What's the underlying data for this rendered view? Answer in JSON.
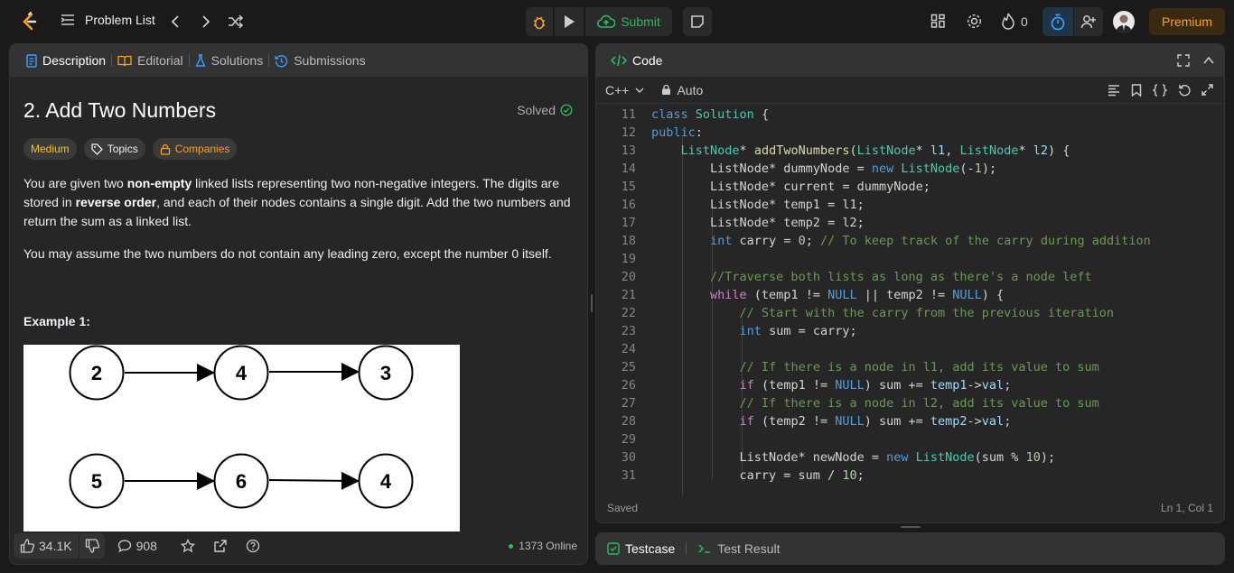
{
  "topbar": {
    "problem_list": "Problem List",
    "submit": "Submit",
    "streak_count": "0",
    "premium": "Premium"
  },
  "icons": [
    "leetcode-logo",
    "list-icon",
    "chevron-left-icon",
    "chevron-right-icon",
    "shuffle-icon",
    "debug-icon",
    "play-icon",
    "cloud-upload-icon",
    "note-icon",
    "layout-icon",
    "gear-icon",
    "fire-icon",
    "timer-icon",
    "add-person-icon",
    "avatar"
  ],
  "left": {
    "tabs": [
      "Description",
      "Editorial",
      "Solutions",
      "Submissions"
    ],
    "title": "2. Add Two Numbers",
    "solved": "Solved",
    "chips": {
      "difficulty": "Medium",
      "topics": "Topics",
      "companies": "Companies"
    },
    "p1_a": "You are given two ",
    "p1_b": "non-empty",
    "p1_c": " linked lists representing two non-negative integers. The digits are stored in ",
    "p1_d": "reverse order",
    "p1_e": ", and each of their nodes contains a single digit. Add the two numbers and return the sum as a linked list.",
    "p2": "You may assume the two numbers do not contain any leading zero, except the number 0 itself.",
    "example": "Example 1:",
    "diagram": {
      "row1": [
        "2",
        "4",
        "3"
      ],
      "row2": [
        "5",
        "6",
        "4"
      ]
    },
    "footer": {
      "likes": "34.1K",
      "comments": "908",
      "online": "1373 Online"
    }
  },
  "code": {
    "tab": "Code",
    "language": "C++",
    "mode": "Auto",
    "status_left": "Saved",
    "status_right": "Ln 1, Col 1",
    "lines": [
      {
        "n": "11",
        "html": "<span class=\"kw\">class</span> <span class=\"ty\">Solution</span> {"
      },
      {
        "n": "12",
        "html": "<span class=\"kw\">public</span>:"
      },
      {
        "n": "13",
        "html": "    <span class=\"ty\">ListNode</span>* <span class=\"fn\">addTwoNumbers</span>(<span class=\"ty\">ListNode</span>* <span class=\"va\">l1</span>, <span class=\"ty\">ListNode</span>* <span class=\"va\">l2</span>) {"
      },
      {
        "n": "14",
        "html": "        ListNode* dummyNode = <span class=\"kw\">new</span> <span class=\"ty\">ListNode</span>(-<span class=\"nm\">1</span>);"
      },
      {
        "n": "15",
        "html": "        ListNode* current = dummyNode;"
      },
      {
        "n": "16",
        "html": "        ListNode* temp1 = l1;"
      },
      {
        "n": "17",
        "html": "        ListNode* temp2 = l2;"
      },
      {
        "n": "18",
        "html": "        <span class=\"kw\">int</span> carry = <span class=\"nm\">0</span>; <span class=\"cm\">// To keep track of the carry during addition</span>"
      },
      {
        "n": "19",
        "html": ""
      },
      {
        "n": "20",
        "html": "        <span class=\"cm\">//Traverse both lists as long as there's a node left</span>"
      },
      {
        "n": "21",
        "html": "        <span class=\"kp\">while</span> (temp1 != <span class=\"kw\">NULL</span> || temp2 != <span class=\"kw\">NULL</span>) {"
      },
      {
        "n": "22",
        "html": "            <span class=\"cm\">// Start with the carry from the previous iteration</span>"
      },
      {
        "n": "23",
        "html": "            <span class=\"kw\">int</span> sum = carry;"
      },
      {
        "n": "24",
        "html": ""
      },
      {
        "n": "25",
        "html": "            <span class=\"cm\">// If there is a node in l1, add its value to sum</span>"
      },
      {
        "n": "26",
        "html": "            <span class=\"kp\">if</span> (temp1 != <span class=\"kw\">NULL</span>) sum += <span class=\"va\">temp1</span>-><span class=\"va\">val</span>;"
      },
      {
        "n": "27",
        "html": "            <span class=\"cm\">// If there is a node in l2, add its value to sum</span>"
      },
      {
        "n": "28",
        "html": "            <span class=\"kp\">if</span> (temp2 != <span class=\"kw\">NULL</span>) sum += <span class=\"va\">temp2</span>-><span class=\"va\">val</span>;"
      },
      {
        "n": "29",
        "html": ""
      },
      {
        "n": "30",
        "html": "            ListNode* newNode = <span class=\"kw\">new</span> <span class=\"ty\">ListNode</span>(sum % <span class=\"nm\">10</span>);"
      },
      {
        "n": "31",
        "html": "            carry = sum / <span class=\"nm\">10</span>;"
      }
    ]
  },
  "bottom": {
    "testcase": "Testcase",
    "test_result": "Test Result"
  }
}
